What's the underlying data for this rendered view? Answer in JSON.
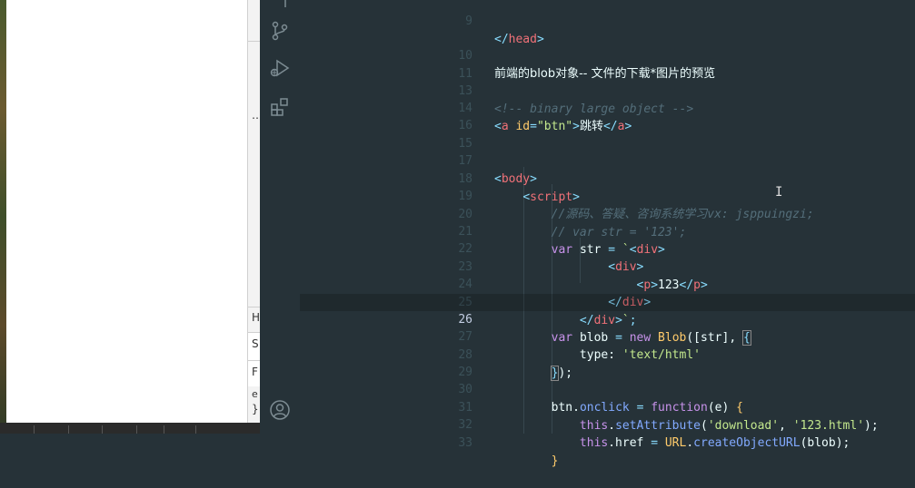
{
  "devtools": {
    "fragments": [
      "H",
      "S",
      "F",
      "e",
      "}"
    ]
  },
  "activity_bar": {
    "icons": [
      "source-control-icon",
      "run-debug-icon",
      "extensions-icon",
      "account-icon"
    ]
  },
  "editor": {
    "current_line": "26",
    "lines": [
      {
        "n": "9",
        "text": "</head>"
      },
      {
        "n": "10",
        "text": "前端的blob对象-- 文件的下载*图片的预览"
      },
      {
        "n": "11",
        "text": ""
      },
      {
        "n": "13",
        "text": "<!-- binary large object -->"
      },
      {
        "n": "14",
        "text": "<a id=\"btn\">跳转</a>"
      },
      {
        "n": "15",
        "text": ""
      },
      {
        "n": "16",
        "text": ""
      },
      {
        "n": "17",
        "text": "<body>"
      },
      {
        "n": "18",
        "text": "    <script>"
      },
      {
        "n": "19",
        "text": "        //源码、答疑、咨询系统学习vx: jsppuingzi;"
      },
      {
        "n": "20",
        "text": "        // var str = '123';"
      },
      {
        "n": "21",
        "text": "        var str = `<div>"
      },
      {
        "n": "22",
        "text": "                <div>"
      },
      {
        "n": "23",
        "text": "                    <p>123</p>"
      },
      {
        "n": "24",
        "text": "                </div>"
      },
      {
        "n": "25",
        "text": "            </div>`;"
      },
      {
        "n": "26",
        "text": "        var blob = new Blob([str], {"
      },
      {
        "n": "27",
        "text": "            type: 'text/html'"
      },
      {
        "n": "28",
        "text": "        });"
      },
      {
        "n": "29",
        "text": ""
      },
      {
        "n": "30",
        "text": "        btn.onclick = function(e) {"
      },
      {
        "n": "31",
        "text": "            this.setAttribute('download', '123.html');"
      },
      {
        "n": "32",
        "text": "            this.href = URL.createObjectURL(blob);"
      },
      {
        "n": "33",
        "text": "        }"
      }
    ]
  }
}
